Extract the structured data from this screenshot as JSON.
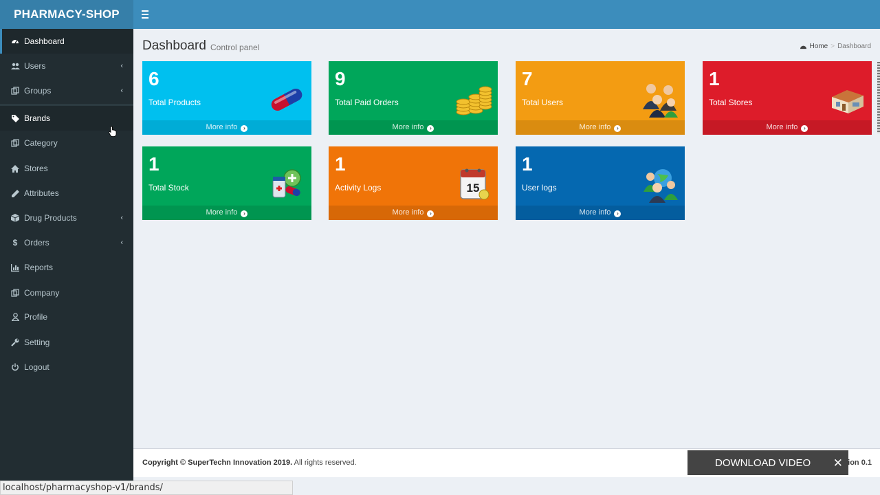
{
  "header": {
    "logo": "PHARMACY-SHOP"
  },
  "sidebar": {
    "items": [
      {
        "label": "Dashboard",
        "icon": "dashboard-icon"
      },
      {
        "label": "Users",
        "icon": "users-icon",
        "caret": "‹"
      },
      {
        "label": "Groups",
        "icon": "groups-icon",
        "caret": "‹"
      },
      {
        "label": "Brands",
        "icon": "tags-icon"
      },
      {
        "label": "Category",
        "icon": "category-icon"
      },
      {
        "label": "Stores",
        "icon": "home-icon"
      },
      {
        "label": "Attributes",
        "icon": "pencil-icon"
      },
      {
        "label": "Drug Products",
        "icon": "cube-icon",
        "caret": "‹"
      },
      {
        "label": "Orders",
        "icon": "dollar-icon",
        "caret": "‹"
      },
      {
        "label": "Reports",
        "icon": "bar-chart-icon"
      },
      {
        "label": "Company",
        "icon": "company-icon"
      },
      {
        "label": "Profile",
        "icon": "user-icon"
      },
      {
        "label": "Setting",
        "icon": "wrench-icon"
      },
      {
        "label": "Logout",
        "icon": "power-icon"
      }
    ]
  },
  "content": {
    "title": "Dashboard",
    "subtitle": "Control panel",
    "breadcrumb": {
      "home": "Home",
      "current": "Dashboard"
    }
  },
  "boxes": [
    {
      "count": "6",
      "label": "Total Products",
      "color": "#00c0ef",
      "icon": "capsule-icon",
      "footer": "More info"
    },
    {
      "count": "9",
      "label": "Total Paid Orders",
      "color": "#00a65a",
      "icon": "coins-icon",
      "footer": "More info"
    },
    {
      "count": "7",
      "label": "Total Users",
      "color": "#f39c12",
      "icon": "people-icon",
      "footer": "More info"
    },
    {
      "count": "1",
      "label": "Total Stores",
      "color": "#dd4b39",
      "icon": "store-icon",
      "footer": "More info"
    },
    {
      "count": "1",
      "label": "Total Stock",
      "color": "#00a65a",
      "icon": "medicine-icon",
      "footer": "More info"
    },
    {
      "count": "1",
      "label": "Activity Logs",
      "color": "#ff851b",
      "icon": "calendar-icon",
      "footer": "More info"
    },
    {
      "count": "1",
      "label": "User logs",
      "color": "#0073b7",
      "icon": "globe-users-icon",
      "footer": "More info"
    }
  ],
  "calendar_day": "15",
  "footer": {
    "copyright_bold": "Copyright © SuperTechn Innovation 2019.",
    "copyright_rest": " All rights reserved.",
    "version": "ion 0.1"
  },
  "download": {
    "label": "DOWNLOAD VIDEO",
    "close": "✕"
  },
  "statusbar": "localhost/pharmacyshop-v1/brands/"
}
